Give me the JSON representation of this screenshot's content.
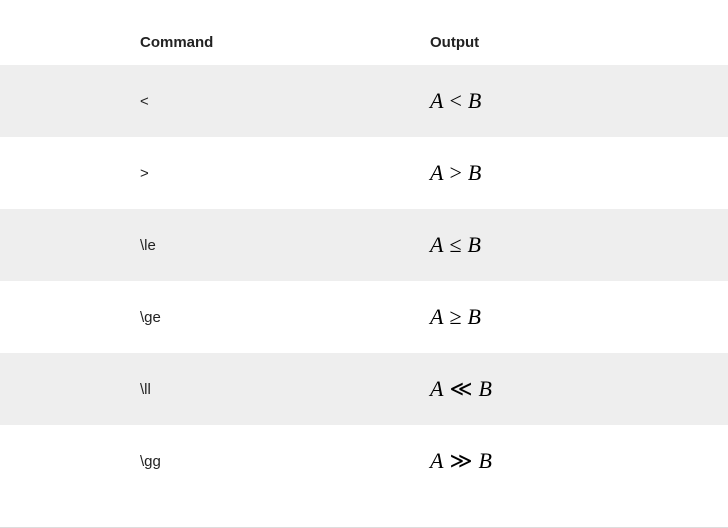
{
  "headers": {
    "command": "Command",
    "output": "Output"
  },
  "rows": [
    {
      "command": "<",
      "left": "A",
      "rel": "<",
      "right": "B"
    },
    {
      "command": ">",
      "left": "A",
      "rel": ">",
      "right": "B"
    },
    {
      "command": "\\le",
      "left": "A",
      "rel": "≤",
      "right": "B"
    },
    {
      "command": "\\ge",
      "left": "A",
      "rel": ">",
      "right": "B",
      "rel_html": "≥"
    },
    {
      "command": "\\ll",
      "left": "A",
      "rel": "≪",
      "right": "B"
    },
    {
      "command": "\\gg",
      "left": "A",
      "rel": "≫",
      "right": "B"
    }
  ]
}
